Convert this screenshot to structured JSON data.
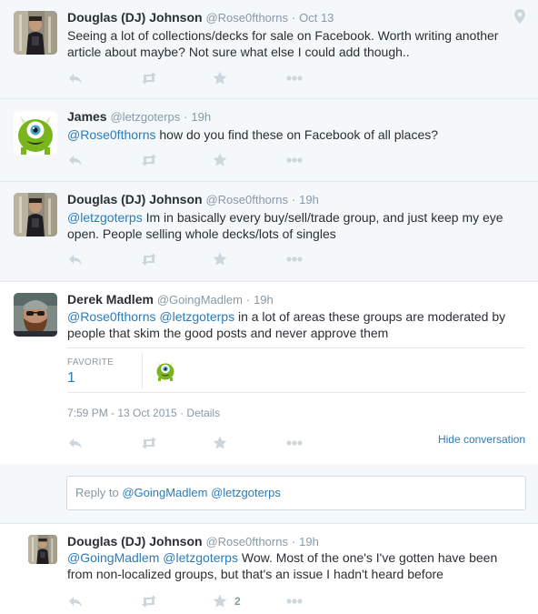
{
  "tweets": [
    {
      "fullname": "Douglas (DJ) Johnson",
      "username": "@Rose0fthorns",
      "time": "Oct 13",
      "text": "Seeing a lot of collections/decks for sale on Facebook. Worth writing another article about maybe? Not sure what else I could add though..",
      "avatar": "dj-avatar"
    },
    {
      "fullname": "James",
      "username": "@letzgoterps",
      "time": "19h",
      "mention": "@Rose0fthorns",
      "text": "how do you find these on Facebook of all places?",
      "avatar": "mike-wazowski-avatar"
    },
    {
      "fullname": "Douglas (DJ) Johnson",
      "username": "@Rose0fthorns",
      "time": "19h",
      "mention": "@letzgoterps",
      "text_line1": "Im in basically every buy/sell/trade group, and just keep my eye",
      "text_line2": "open. People selling whole decks/lots of singles",
      "avatar": "dj-avatar"
    },
    {
      "fullname": "Derek Madlem",
      "username": "@GoingMadlem",
      "time": "19h",
      "mention1": "@Rose0fthorns",
      "mention2": "@letzgoterps",
      "text_line1": "in a lot of areas these groups are moderated by",
      "text_line2": "people that skim the good posts and never approve them",
      "favorite_label": "FAVORITE",
      "favorite_count": "1",
      "timestamp": "7:59 PM - 13 Oct 2015",
      "separator": "·",
      "details": "Details",
      "hide_conversation": "Hide conversation",
      "avatar": "derek-avatar"
    },
    {
      "fullname": "Douglas (DJ) Johnson",
      "username": "@Rose0fthorns",
      "time": "19h",
      "mention1": "@GoingMadlem",
      "mention2": "@letzgoterps",
      "text_line1": "Wow. Most of the one's I've gotten have been",
      "text_line2": "from non-localized groups, but that's an issue I hadn't heard before",
      "favorite_count": "2",
      "avatar": "dj-avatar"
    }
  ],
  "reply_box": {
    "prefix": "Reply to",
    "mention1": "@GoingMadlem",
    "mention2": "@letzgoterps"
  },
  "dot": "·",
  "colors": {
    "link": "#2b7bb9",
    "muted": "#8899a6",
    "icon": "#ccd6dd",
    "ancestor_bg": "#f5f8fa"
  },
  "icons": [
    "reply-icon",
    "retweet-icon",
    "favorite-icon",
    "more-icon",
    "location-icon"
  ]
}
